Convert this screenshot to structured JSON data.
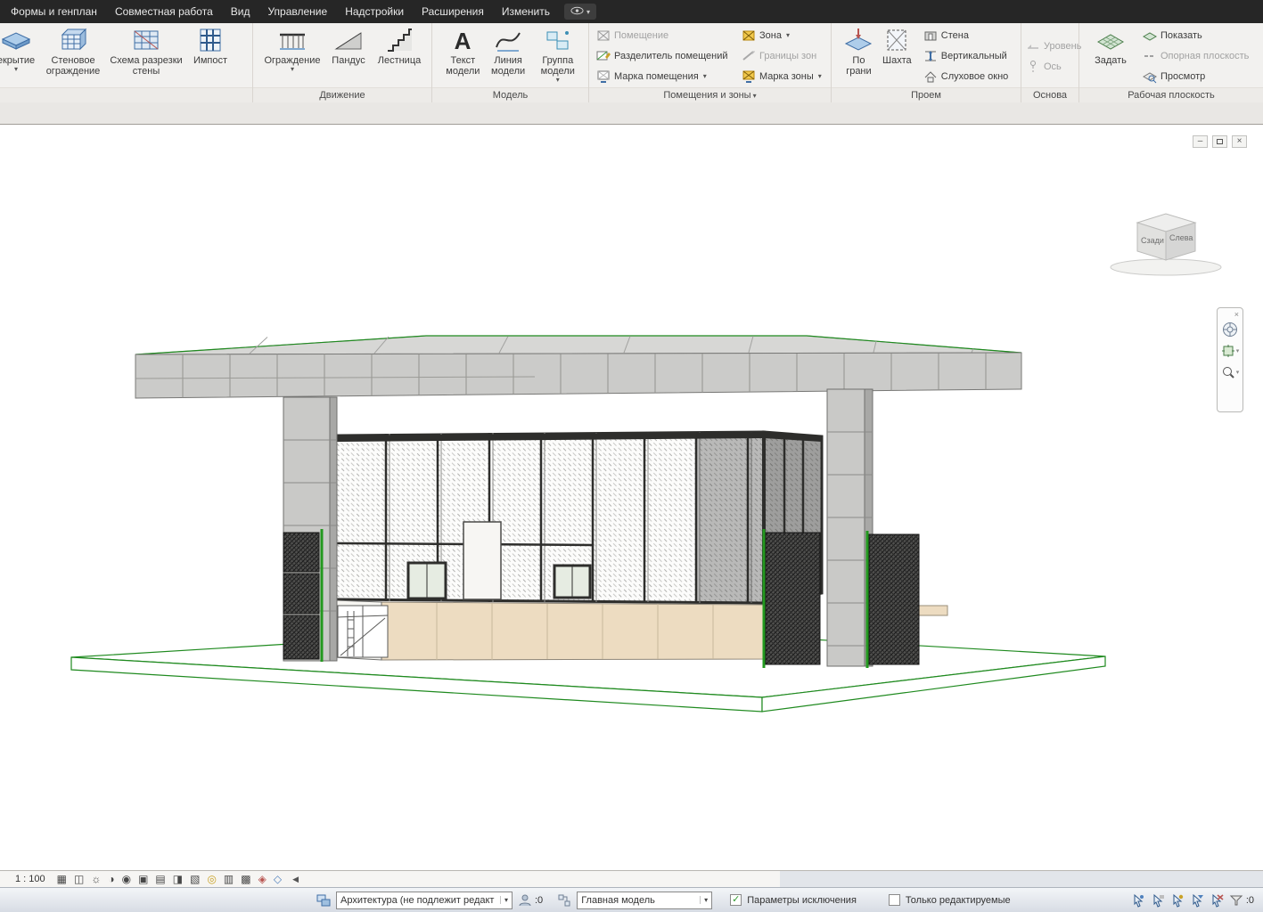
{
  "glyphs": {
    "caret": "▾",
    "minimize": "–",
    "close": "×"
  },
  "menu": {
    "items": [
      "Формы и генплан",
      "Совместная работа",
      "Вид",
      "Управление",
      "Надстройки",
      "Расширения",
      "Изменить"
    ]
  },
  "ribbon": {
    "construct": {
      "floor": "екрытие",
      "wall_sweep": "Стеновое ограждение",
      "reveal": "Схема разрезки стены",
      "mullion": "Импост"
    },
    "circulation": {
      "label": "Движение",
      "railing": "Ограждение",
      "ramp": "Пандус",
      "stair": "Лестница"
    },
    "model": {
      "label": "Модель",
      "text": "Текст модели",
      "line": "Линия модели",
      "group": "Группа модели"
    },
    "rooms": {
      "label": "Помещения и зоны",
      "room": "Помещение",
      "separator": "Разделитель помещений",
      "room_tag": "Марка помещения",
      "area": "Зона",
      "area_boundary": "Границы зон",
      "area_tag": "Марка зоны"
    },
    "opening": {
      "label": "Проем",
      "by_face": "По грани",
      "shaft": "Шахта",
      "wall": "Стена",
      "vertical": "Вертикальный",
      "dormer": "Слуховое окно"
    },
    "datum": {
      "label": "Основа",
      "level": "Уровень",
      "grid": "Ось"
    },
    "workplane": {
      "label": "Рабочая плоскость",
      "set": "Задать",
      "show": "Показать",
      "ref_plane": "Опорная плоскость",
      "viewer": "Просмотр"
    }
  },
  "viewcube": {
    "back": "Сзади",
    "left": "Слева"
  },
  "viewbar": {
    "scale": "1 : 100",
    "collapse": "◀",
    "glyphs": [
      "▦",
      "◫",
      "☼",
      "◑",
      "◉",
      "▣",
      "▤",
      "◨",
      "▧",
      "◎",
      "▥",
      "▩",
      "◈",
      "◇"
    ]
  },
  "statusbar": {
    "workset": "Архитектура (не подлежит редакт",
    "requests_count": ":0",
    "design_option": "Главная модель",
    "exclusion": "Параметры исключения",
    "editable_only": "Только редактируемые",
    "filter_count": ":0",
    "check_glyph": "✓"
  },
  "scene_colors": {
    "edge_green": "#1f8a1f",
    "roof_gray": "#cbcbc9",
    "wall_beige": "#eddcc1",
    "frame_dark": "#2e2e2c",
    "column_gray": "#c9c9c7",
    "fence_dark": "#50504e",
    "post_green": "#23991f"
  }
}
